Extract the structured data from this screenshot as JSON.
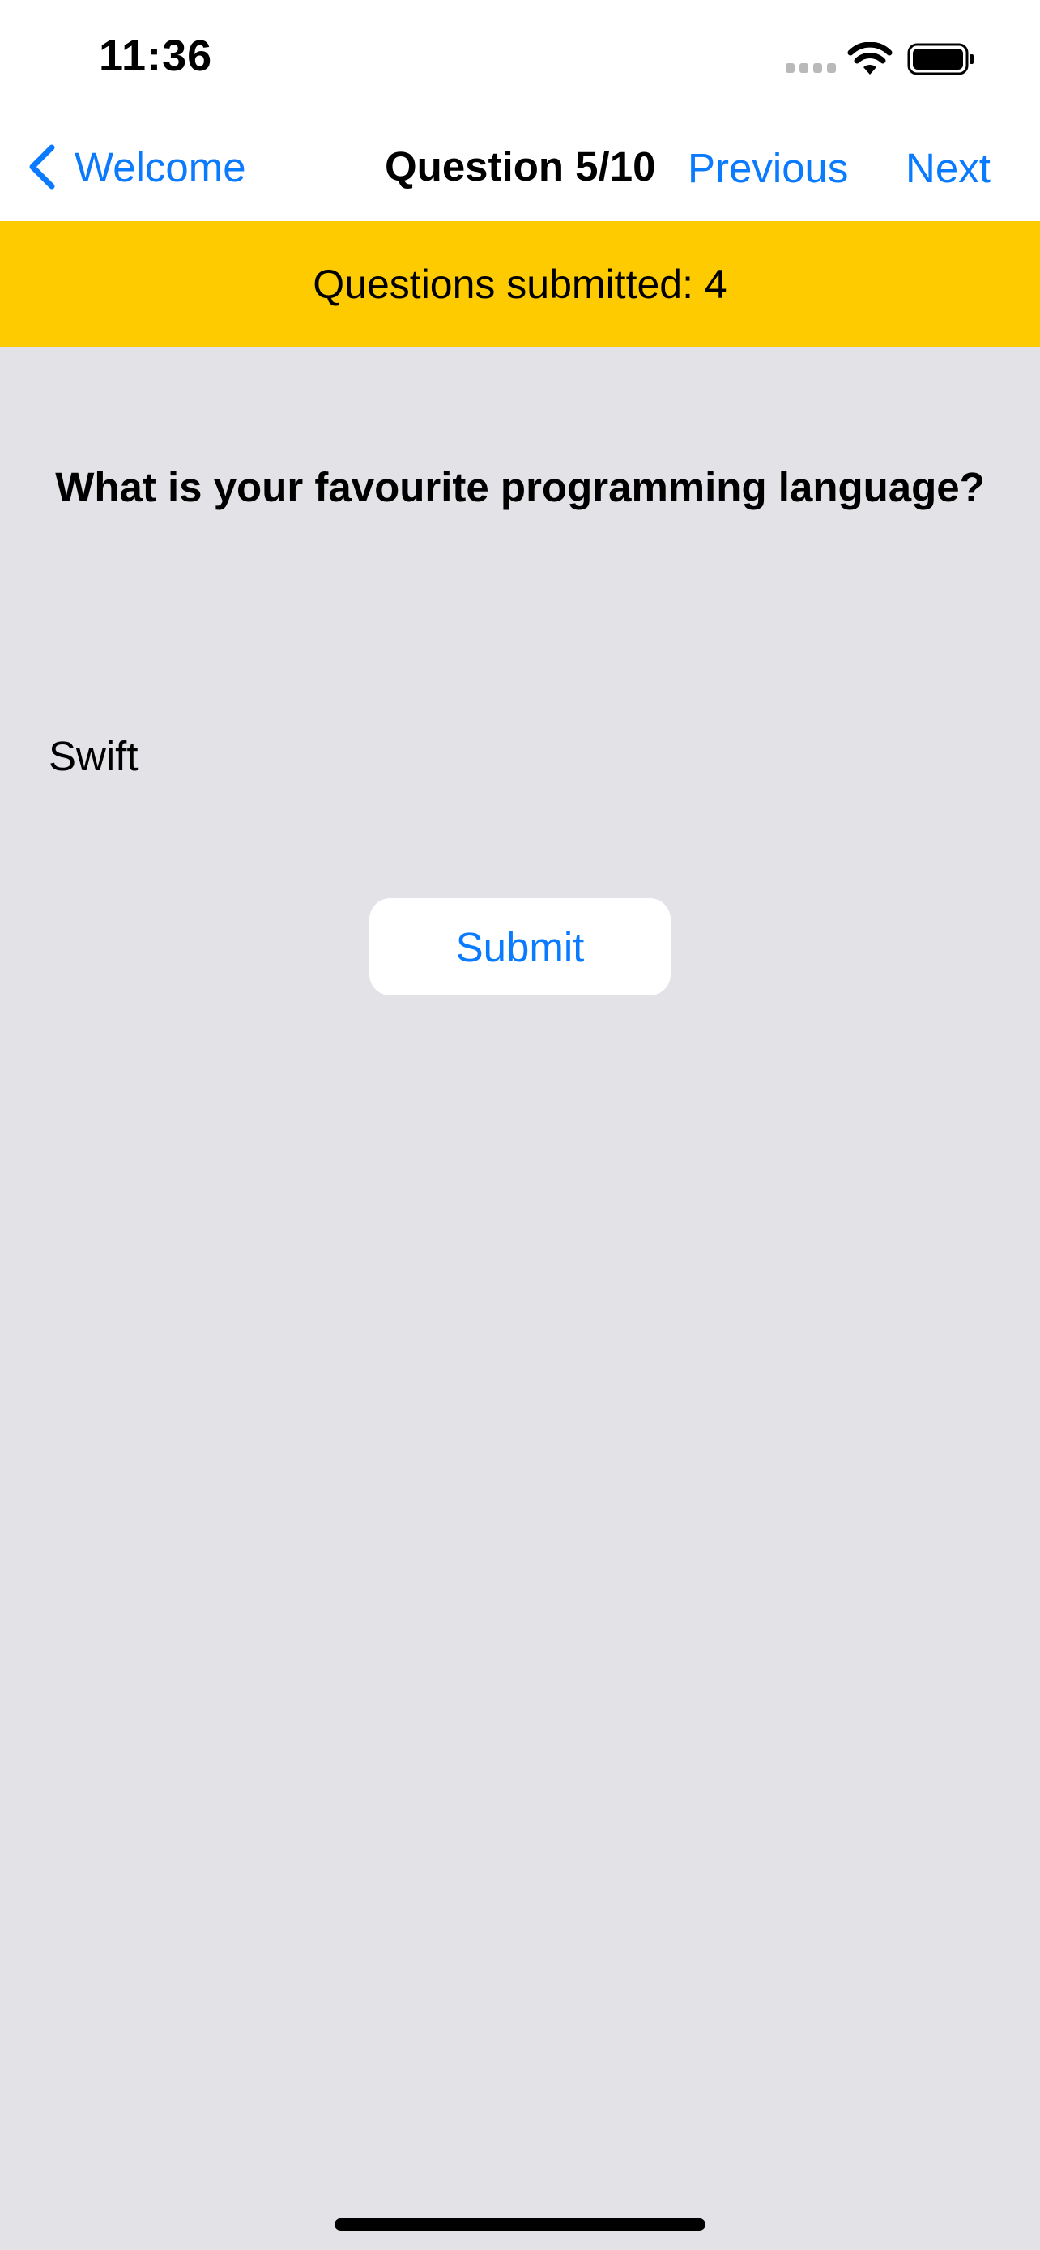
{
  "status_bar": {
    "time": "11:36"
  },
  "nav": {
    "back_label": "Welcome",
    "title": "Question 5/10",
    "previous_label": "Previous",
    "next_label": "Next"
  },
  "banner": {
    "text": "Questions submitted: 4"
  },
  "question": {
    "text": "What is your favourite programming language?",
    "answer": "Swift"
  },
  "actions": {
    "submit_label": "Submit"
  },
  "colors": {
    "accent": "#0a7aff",
    "banner": "#fecb01",
    "background": "#e3e3e7"
  },
  "icons": [
    "signal-icon",
    "wifi-icon",
    "battery-icon",
    "chevron-left-icon"
  ]
}
